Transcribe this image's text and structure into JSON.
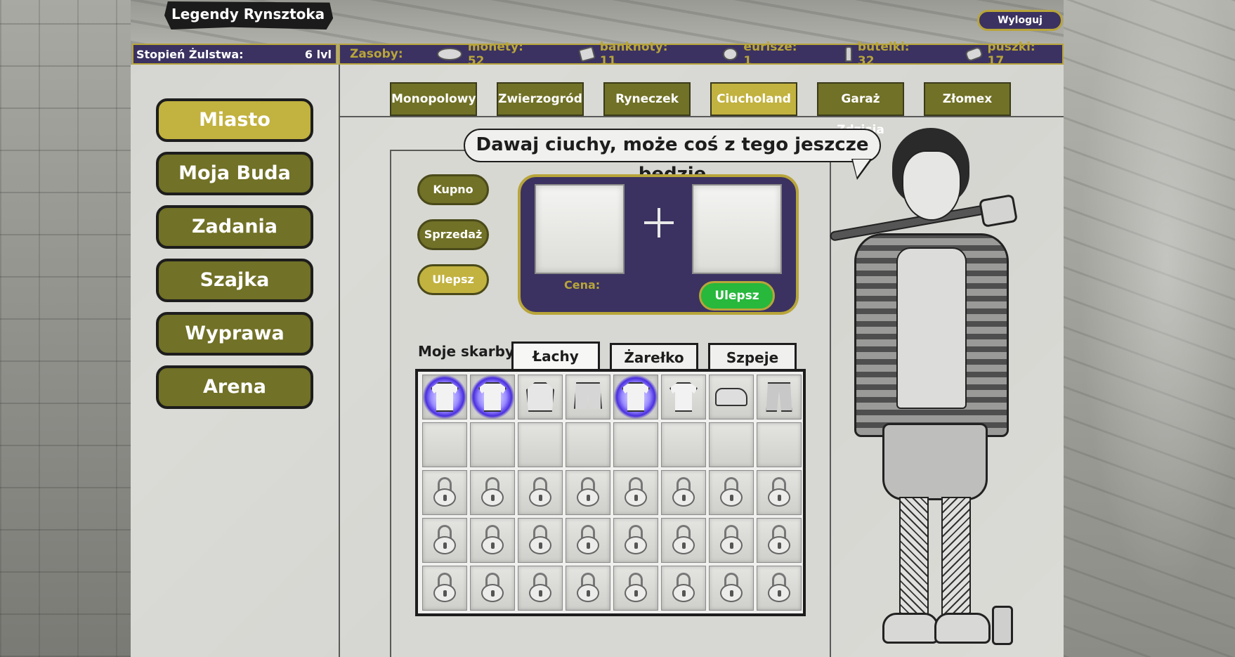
{
  "header": {
    "game_title": "Legendy Rynsztoka",
    "logout_label": "Wyloguj"
  },
  "status": {
    "level_label": "Stopień Żulstwa:",
    "level_value": "6 lvl"
  },
  "resources": {
    "label": "Zasoby:",
    "items": [
      {
        "icon": "coins-icon",
        "text": "monety: 52"
      },
      {
        "icon": "banknote-icon",
        "text": "banknoty: 11"
      },
      {
        "icon": "euro-coin-icon",
        "text": "eurisze: 1"
      },
      {
        "icon": "bottle-icon",
        "text": "butelki: 32"
      },
      {
        "icon": "can-icon",
        "text": "puszki: 17"
      }
    ]
  },
  "sidebar": {
    "items": [
      {
        "label": "Miasto",
        "active": true
      },
      {
        "label": "Moja Buda",
        "active": false
      },
      {
        "label": "Zadania",
        "active": false
      },
      {
        "label": "Szajka",
        "active": false
      },
      {
        "label": "Wyprawa",
        "active": false
      },
      {
        "label": "Arena",
        "active": false
      }
    ]
  },
  "shops": {
    "tabs": [
      {
        "label": "Monopolowy",
        "active": false
      },
      {
        "label": "Zwierzogród",
        "active": false
      },
      {
        "label": "Ryneczek",
        "active": false
      },
      {
        "label": "Ciucholand",
        "active": true
      },
      {
        "label": "Garaż Zdzisia",
        "active": false
      },
      {
        "label": "Złomex",
        "active": false
      }
    ]
  },
  "npc": {
    "speech": "Dawaj ciuchy, może coś z tego jeszcze będzie"
  },
  "modes": {
    "buy": "Kupno",
    "sell": "Sprzedaż",
    "upgrade": "Ulepsz"
  },
  "upgrade_panel": {
    "price_label": "Cena:",
    "action_label": "Ulepsz"
  },
  "inventory": {
    "label": "Moje skarby:",
    "tabs": [
      {
        "label": "Łachy",
        "active": true
      },
      {
        "label": "Żarełko",
        "active": false
      },
      {
        "label": "Szpeje",
        "active": false
      }
    ],
    "items": [
      {
        "icon": "tshirt-icon",
        "glow": true
      },
      {
        "icon": "tshirt-icon",
        "glow": true
      },
      {
        "icon": "hoodie-icon",
        "glow": false
      },
      {
        "icon": "shorts-icon",
        "glow": false
      },
      {
        "icon": "tshirt-icon",
        "glow": true
      },
      {
        "icon": "tshirt-icon",
        "glow": false
      },
      {
        "icon": "shoes-icon",
        "glow": false
      },
      {
        "icon": "pants-icon",
        "glow": false
      }
    ],
    "empty_slots": 8,
    "locked_slots": 24
  },
  "colors": {
    "olive": "#717127",
    "gold": "#c2b23f",
    "purple": "#3b3261",
    "green": "#27b83c"
  }
}
